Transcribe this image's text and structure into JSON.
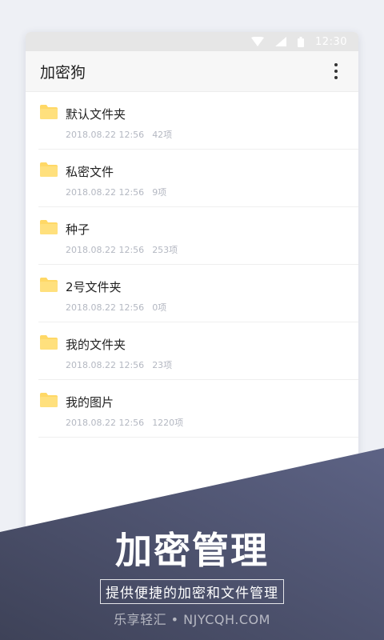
{
  "status_bar": {
    "time": "12:30"
  },
  "app_bar": {
    "title": "加密狗",
    "menu_icon": "more-vert-icon"
  },
  "folders": [
    {
      "name": "默认文件夹",
      "date": "2018.08.22 12:56",
      "count": "42项"
    },
    {
      "name": "私密文件",
      "date": "2018.08.22 12:56",
      "count": "9项"
    },
    {
      "name": "种子",
      "date": "2018.08.22 12:56",
      "count": "253项"
    },
    {
      "name": "2号文件夹",
      "date": "2018.08.22 12:56",
      "count": "0项"
    },
    {
      "name": "我的文件夹",
      "date": "2018.08.22 12:56",
      "count": "23项"
    },
    {
      "name": "我的图片",
      "date": "2018.08.22 12:56",
      "count": "1220项"
    }
  ],
  "promo": {
    "headline": "加密管理",
    "tagline": "提供便捷的加密和文件管理",
    "watermark": "乐享轻汇 • NJYCQH.COM"
  },
  "colors": {
    "folder": "#ffd866",
    "banner_dark": "#3e4258",
    "banner_light": "#5d6385",
    "text_primary": "#222222",
    "text_secondary": "#b4b8c2"
  }
}
